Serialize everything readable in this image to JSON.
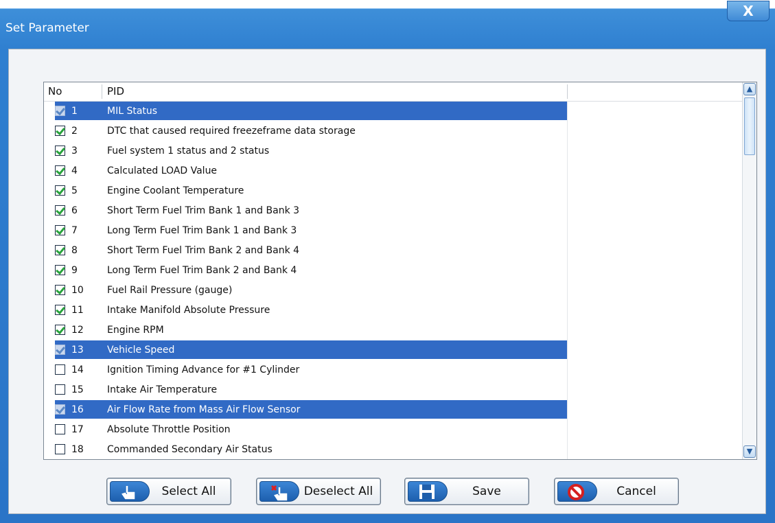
{
  "window": {
    "title": "Set Parameter",
    "close_label": "X"
  },
  "table": {
    "columns": [
      "No",
      "PID",
      ""
    ],
    "rows": [
      {
        "no": "1",
        "pid": "MIL Status",
        "checked": true,
        "selected": true
      },
      {
        "no": "2",
        "pid": "DTC that caused required freezeframe data storage",
        "checked": true,
        "selected": false
      },
      {
        "no": "3",
        "pid": "Fuel system 1 status and 2 status",
        "checked": true,
        "selected": false
      },
      {
        "no": "4",
        "pid": "Calculated LOAD Value",
        "checked": true,
        "selected": false
      },
      {
        "no": "5",
        "pid": "Engine Coolant Temperature",
        "checked": true,
        "selected": false
      },
      {
        "no": "6",
        "pid": "Short Term Fuel Trim Bank 1 and Bank 3",
        "checked": true,
        "selected": false
      },
      {
        "no": "7",
        "pid": "Long Term Fuel Trim Bank 1 and Bank 3",
        "checked": true,
        "selected": false
      },
      {
        "no": "8",
        "pid": "Short Term Fuel Trim Bank 2 and Bank 4",
        "checked": true,
        "selected": false
      },
      {
        "no": "9",
        "pid": "Long Term Fuel Trim Bank 2 and Bank 4",
        "checked": true,
        "selected": false
      },
      {
        "no": "10",
        "pid": "Fuel Rail Pressure (gauge)",
        "checked": true,
        "selected": false
      },
      {
        "no": "11",
        "pid": "Intake Manifold Absolute Pressure",
        "checked": true,
        "selected": false
      },
      {
        "no": "12",
        "pid": "Engine RPM",
        "checked": true,
        "selected": false
      },
      {
        "no": "13",
        "pid": "Vehicle Speed",
        "checked": true,
        "selected": true
      },
      {
        "no": "14",
        "pid": "Ignition Timing Advance for #1 Cylinder",
        "checked": false,
        "selected": false
      },
      {
        "no": "15",
        "pid": "Intake Air Temperature",
        "checked": false,
        "selected": false
      },
      {
        "no": "16",
        "pid": "Air Flow Rate from Mass Air Flow Sensor",
        "checked": true,
        "selected": true
      },
      {
        "no": "17",
        "pid": "Absolute Throttle Position",
        "checked": false,
        "selected": false
      },
      {
        "no": "18",
        "pid": "Commanded Secondary Air Status",
        "checked": false,
        "selected": false
      }
    ]
  },
  "buttons": {
    "select_all": "Select All",
    "deselect_all": "Deselect All",
    "save": "Save",
    "cancel": "Cancel"
  },
  "icons": {
    "select_all": "hand-pointer-icon",
    "deselect_all": "hand-pointer-remove-icon",
    "save": "floppy-disk-icon",
    "cancel": "prohibited-icon"
  },
  "colors": {
    "window_blue": "#2f7fd0",
    "selection": "#316ac5",
    "check_green": "#27a23b",
    "cancel_red": "#d42020"
  }
}
